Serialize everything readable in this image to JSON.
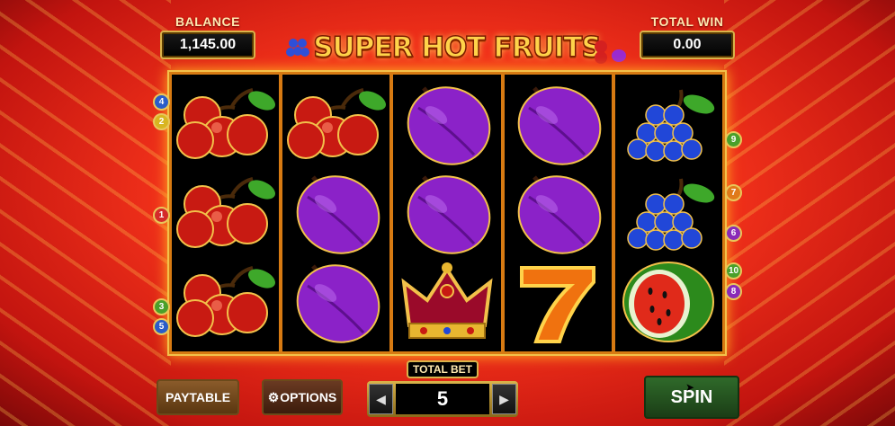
{
  "game": {
    "title": "SUPER HOT FRUITS"
  },
  "balance": {
    "label": "BALANCE",
    "value": "1,145.00"
  },
  "total_win": {
    "label": "TOTAL WIN",
    "value": "0.00"
  },
  "reels": [
    [
      "cherries",
      "cherries",
      "cherries"
    ],
    [
      "cherries",
      "plum",
      "plum"
    ],
    [
      "plum",
      "plum",
      "crown"
    ],
    [
      "plum",
      "plum",
      "seven"
    ],
    [
      "grapes",
      "grapes",
      "watermelon"
    ]
  ],
  "paylines_left": [
    {
      "n": "4",
      "color": "#2a5cc8"
    },
    {
      "n": "2",
      "color": "#d8b520"
    },
    {
      "n": "1",
      "color": "#d42a2a"
    },
    {
      "n": "3",
      "color": "#4aa02a"
    },
    {
      "n": "5",
      "color": "#2a5cc8"
    }
  ],
  "paylines_right": [
    {
      "n": "9",
      "color": "#4aa02a"
    },
    {
      "n": "7",
      "color": "#e07a1a"
    },
    {
      "n": "6",
      "color": "#8a2ab8"
    },
    {
      "n": "10",
      "color": "#4aa02a"
    },
    {
      "n": "8",
      "color": "#8a2ab8"
    }
  ],
  "controls": {
    "paytable_label": "PAYTABLE",
    "options_label": "OPTIONS",
    "total_bet_label": "TOTAL BET",
    "total_bet_value": "5",
    "spin_label": "SPIN"
  }
}
